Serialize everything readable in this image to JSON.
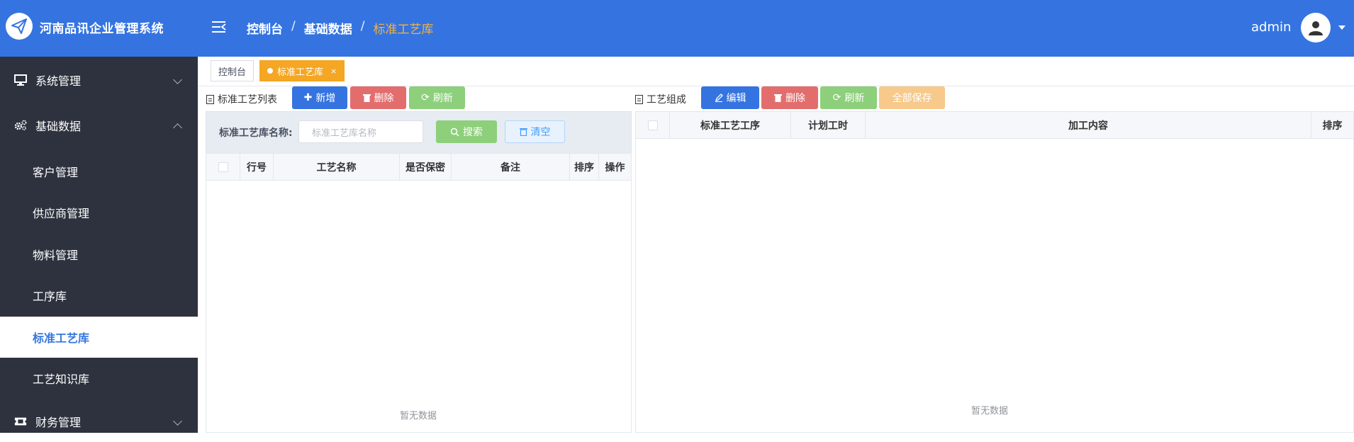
{
  "header": {
    "app_title": "河南品讯企业管理系统",
    "breadcrumb": [
      "控制台",
      "基础数据",
      "标准工艺库"
    ],
    "breadcrumb_sep": "/",
    "user": "admin",
    "bg_color": "#3574e0",
    "accent_color": "#f5b23a"
  },
  "sidebar": {
    "groups": [
      {
        "label": "系统管理",
        "icon": "monitor-icon",
        "expanded": false
      },
      {
        "label": "基础数据",
        "icon": "gears-icon",
        "expanded": true
      },
      {
        "label": "财务管理",
        "icon": "ticket-icon",
        "expanded": false
      }
    ],
    "items": [
      "客户管理",
      "供应商管理",
      "物料管理",
      "工序库",
      "标准工艺库",
      "工艺知识库"
    ],
    "active_item": "标准工艺库"
  },
  "tabs": [
    {
      "label": "控制台",
      "active": false
    },
    {
      "label": "标准工艺库",
      "active": true,
      "close": "×"
    }
  ],
  "left_panel": {
    "title": "标准工艺列表",
    "buttons": {
      "add": "新增",
      "delete": "删除",
      "refresh": "刷新"
    },
    "search": {
      "label": "标准工艺库名称:",
      "placeholder": "标准工艺库名称",
      "search_btn": "搜索",
      "clear_btn": "清空"
    },
    "columns": [
      "行号",
      "工艺名称",
      "是否保密",
      "备注",
      "排序",
      "操作"
    ],
    "empty_text": "暂无数据"
  },
  "right_panel": {
    "title": "工艺组成",
    "buttons": {
      "edit": "编辑",
      "delete": "删除",
      "refresh": "刷新",
      "save_all": "全部保存"
    },
    "columns": [
      "标准工艺工序",
      "计划工时",
      "加工内容",
      "排序"
    ],
    "empty_text": "暂无数据"
  }
}
